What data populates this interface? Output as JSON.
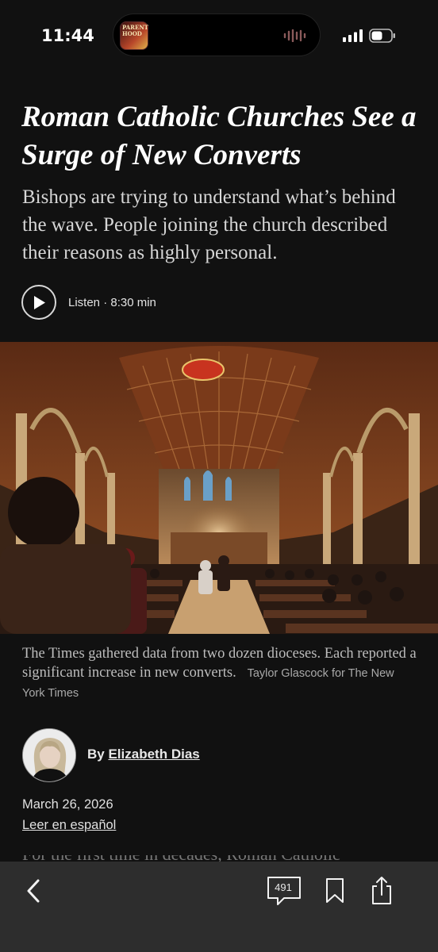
{
  "status_bar": {
    "time": "11:44",
    "now_playing_art": "PARENT HOOD"
  },
  "article": {
    "headline": "Roman Catholic Churches See a Surge of New Converts",
    "summary": "Bishops are trying to understand what’s behind the wave. People joining the church described their reasons as highly personal.",
    "listen_label": "Listen · 8:30 min",
    "image_caption": "The Times gathered data from two dozen dioceses. Each reported a significant increase in new converts.",
    "image_credit": "Taylor Glascock for The New York Times",
    "byline_prefix": "By",
    "author": "Elizabeth Dias",
    "date": "March 26, 2026",
    "language_link": "Leer en español",
    "next_text": "For the first time in decades, Roman Catholic"
  },
  "toolbar": {
    "comment_count": "491",
    "icons": [
      "back-chevron-icon",
      "comment-icon",
      "bookmark-icon",
      "share-icon"
    ]
  },
  "colors": {
    "background": "#111111",
    "toolbar": "#2d2d2d",
    "text": "#ffffff",
    "secondary_text": "#bdbdbd"
  }
}
